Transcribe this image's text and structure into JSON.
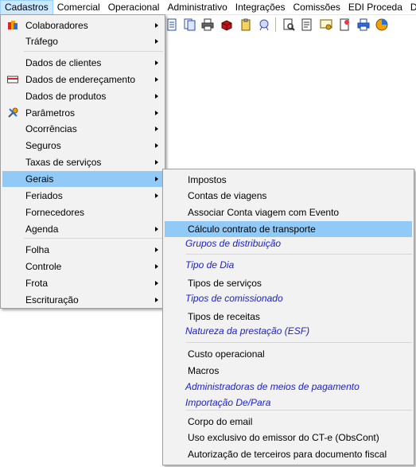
{
  "menubar": {
    "items": [
      "Cadastros",
      "Comercial",
      "Operacional",
      "Administrativo",
      "Integrações",
      "Comissões",
      "EDI Proceda",
      "Do"
    ]
  },
  "cadastros_menu": {
    "items": [
      {
        "label": "Colaboradores",
        "submenu": true,
        "icon": "people-icon"
      },
      {
        "label": "Tráfego",
        "submenu": true
      },
      {
        "label": "Dados de clientes",
        "submenu": true
      },
      {
        "label": "Dados de endereçamento",
        "submenu": true,
        "icon": "card-icon"
      },
      {
        "label": "Dados de produtos",
        "submenu": true
      },
      {
        "label": "Parâmetros",
        "submenu": true,
        "icon": "tools-icon"
      },
      {
        "label": "Ocorrências",
        "submenu": true
      },
      {
        "label": "Seguros",
        "submenu": true
      },
      {
        "label": "Taxas de serviços",
        "submenu": true
      },
      {
        "label": "Gerais",
        "submenu": true,
        "highlighted": true
      },
      {
        "label": "Feriados",
        "submenu": true
      },
      {
        "label": "Fornecedores",
        "submenu": false
      },
      {
        "label": "Agenda",
        "submenu": true
      },
      {
        "label": "Folha",
        "submenu": true
      },
      {
        "label": "Controle",
        "submenu": true
      },
      {
        "label": "Frota",
        "submenu": true
      },
      {
        "label": "Escrituração",
        "submenu": true
      }
    ]
  },
  "gerais_submenu": {
    "items": [
      {
        "label": "Impostos"
      },
      {
        "label": "Contas de viagens"
      },
      {
        "label": "Associar Conta viagem com Evento"
      },
      {
        "label": "Cálculo contrato de transporte",
        "highlighted": true
      },
      {
        "label": "Grupos de distribuição",
        "link": true
      },
      {
        "label": "Tipo de Dia",
        "link": true
      },
      {
        "label": "Tipos de serviços"
      },
      {
        "label": "Tipos de comissionado",
        "link": true
      },
      {
        "label": "Tipos de receitas"
      },
      {
        "label": "Natureza da prestação (ESF)",
        "link": true
      },
      {
        "label": "Custo operacional"
      },
      {
        "label": "Macros"
      },
      {
        "label": "Administradoras de meios de pagamento",
        "link": true
      },
      {
        "label": "Importação De/Para",
        "link": true
      },
      {
        "label": "Corpo do email"
      },
      {
        "label": "Uso exclusivo do emissor do CT-e (ObsCont)"
      },
      {
        "label": "Autorização de terceiros para documento fiscal"
      }
    ]
  },
  "colors": {
    "highlight": "#91c9f7",
    "link_text": "#1e22c8",
    "menu_bg": "#f2f2f2"
  }
}
